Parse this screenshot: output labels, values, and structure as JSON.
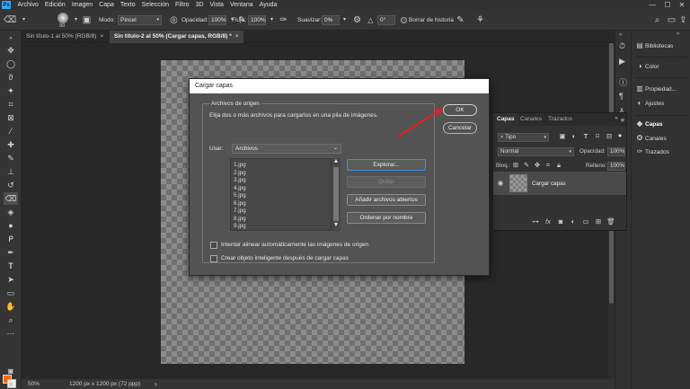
{
  "colors": {
    "accent_blue": "#31a8ff",
    "foreground_swatch": "#ff6a00",
    "background_swatch": "#ffffff",
    "annotation_arrow": "#e02020"
  },
  "menubar": {
    "app_icon": "Ps",
    "items": [
      "Archivo",
      "Edición",
      "Imagen",
      "Capa",
      "Texto",
      "Selección",
      "Filtro",
      "3D",
      "Vista",
      "Ventana",
      "Ayuda"
    ],
    "window_controls": [
      "—",
      "☐",
      "✕"
    ]
  },
  "options_bar": {
    "brush_size": "90",
    "mode_label": "Modo:",
    "mode_value": "Pincel",
    "opacity_label": "Opacidad:",
    "opacity_value": "100%",
    "flow_label": "Flujo:",
    "flow_value": "100%",
    "smooth_label": "Suavizar:",
    "smooth_value": "0%",
    "angle_value": "0°",
    "erase_history_label": "Borrar de historia"
  },
  "tabs": [
    {
      "label": "Sin título-1 al 50% (RGB/8)",
      "close": "×"
    },
    {
      "label": "Sin título-2 al 50% (Cargar capas, RGB/8) *",
      "close": "×"
    }
  ],
  "status": {
    "zoom": "50%",
    "doc_info": "1200 px x 1200 px (72 ppp)",
    "nav_arrow": "›"
  },
  "layers_panel": {
    "tabs": [
      "Capas",
      "Canales",
      "Trazados"
    ],
    "filter_value": "Tipo",
    "blend_mode": "Normal",
    "opacity_label": "Opacidad:",
    "opacity_value": "100%",
    "lock_label": "Bloq.:",
    "fill_label": "Relleno:",
    "fill_value": "100%",
    "layer_name": "Cargar capas"
  },
  "dock": {
    "items": [
      "Bibliotecas",
      "Color",
      "Propiedad...",
      "Ajustes",
      "Capas",
      "Canales",
      "Trazados"
    ]
  },
  "dialog": {
    "title": "Cargar capas",
    "group_title": "Archivos de origen",
    "instructions": "Elija dos o más archivos para cargarlos en una pila de imágenes.",
    "use_label": "Usar:",
    "use_value": "Archivos",
    "files": [
      "1.jpg",
      "2.jpg",
      "3.jpg",
      "4.jpg",
      "5.jpg",
      "6.jpg",
      "7.jpg",
      "8.jpg",
      "9.jpg"
    ],
    "browse_button": "Explorar...",
    "remove_button": "Quitar",
    "add_open_button": "Añadir archivos abiertos",
    "sort_button": "Ordenar por nombre",
    "auto_align_label": "Intentar alinear automáticamente las imágenes de origen",
    "smart_object_label": "Crear objeto inteligente después de cargar capas",
    "ok_button": "OK",
    "cancel_button": "Cancelar"
  }
}
